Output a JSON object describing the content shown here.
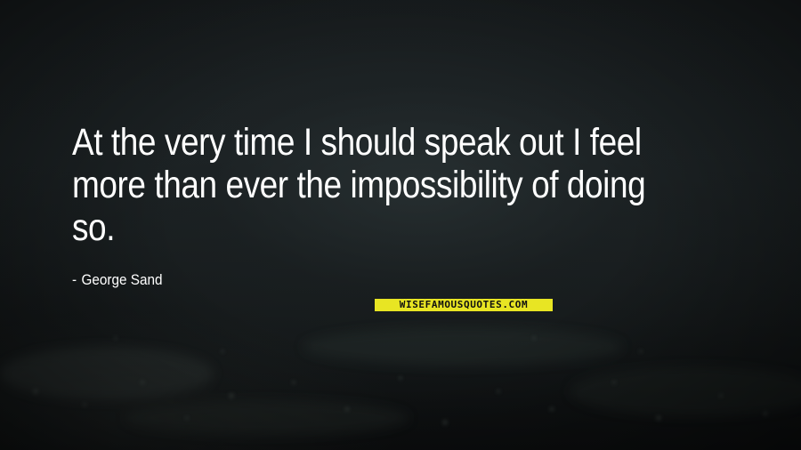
{
  "quote": {
    "text": "At the very time I should speak out I feel more than ever the impossibility of doing so.",
    "author_dash": "-",
    "author": "George Sand"
  },
  "watermark": {
    "text": "WISEFAMOUSQUOTES.COM",
    "color": "#e8e523"
  },
  "colors": {
    "text": "#ffffff",
    "background": "#15191b"
  }
}
